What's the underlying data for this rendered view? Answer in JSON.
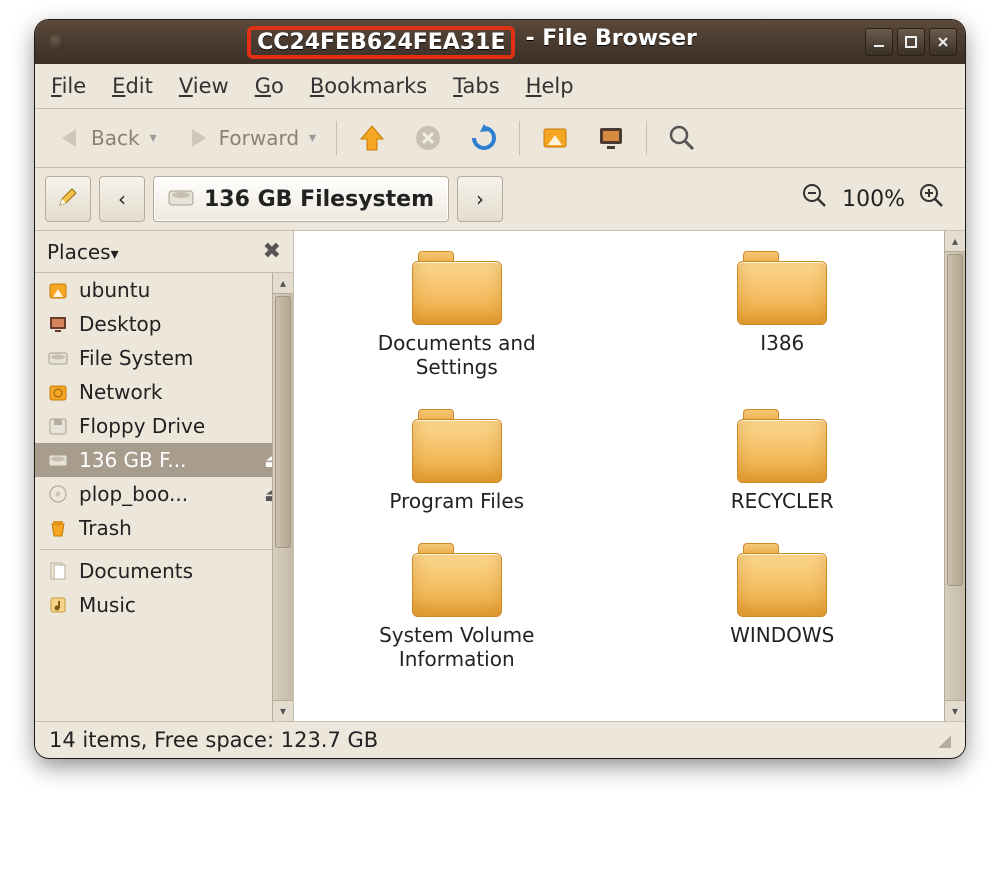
{
  "window": {
    "title_id": "CC24FEB624FEA31E",
    "title_suffix": " - File Browser"
  },
  "menubar": [
    "File",
    "Edit",
    "View",
    "Go",
    "Bookmarks",
    "Tabs",
    "Help"
  ],
  "toolbar": {
    "back": "Back",
    "forward": "Forward"
  },
  "locationbar": {
    "path_label": "136 GB Filesystem",
    "zoom_text": "100%"
  },
  "sidebar": {
    "header": "Places",
    "items": [
      {
        "label": "ubuntu",
        "icon": "home",
        "eject": false
      },
      {
        "label": "Desktop",
        "icon": "desktop",
        "eject": false
      },
      {
        "label": "File System",
        "icon": "drive",
        "eject": false
      },
      {
        "label": "Network",
        "icon": "network",
        "eject": false
      },
      {
        "label": "Floppy Drive",
        "icon": "floppy",
        "eject": false
      },
      {
        "label": "136 GB F...",
        "icon": "drive",
        "eject": true,
        "selected": true
      },
      {
        "label": "plop_boo...",
        "icon": "cd",
        "eject": true
      },
      {
        "label": "Trash",
        "icon": "trash",
        "eject": false
      }
    ],
    "bookmarks": [
      {
        "label": "Documents",
        "icon": "docs"
      },
      {
        "label": "Music",
        "icon": "music"
      }
    ]
  },
  "folders": [
    "Documents and Settings",
    "I386",
    "Program Files",
    "RECYCLER",
    "System Volume Information",
    "WINDOWS"
  ],
  "statusbar": {
    "text": "14 items, Free space: 123.7 GB"
  }
}
